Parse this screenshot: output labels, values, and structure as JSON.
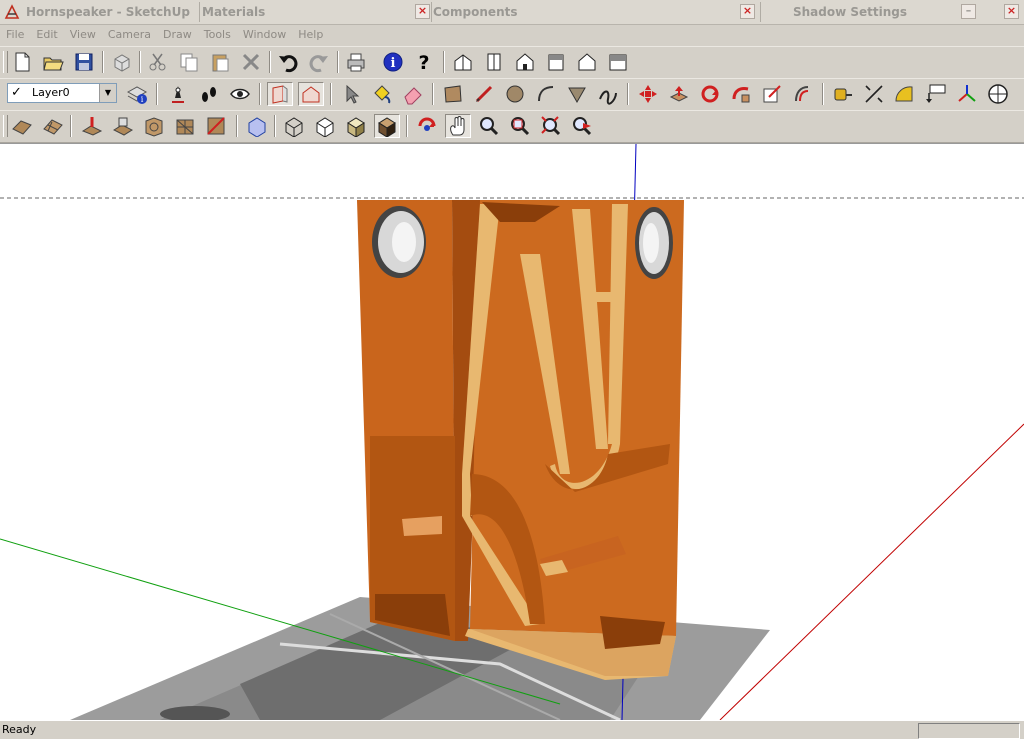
{
  "window": {
    "title": "Hornspeaker - SketchUp",
    "panels": [
      "Materials",
      "Components",
      "Shadow Settings"
    ],
    "close_glyph": "×",
    "minimize_glyph": "–"
  },
  "menu": [
    "File",
    "Edit",
    "View",
    "Camera",
    "Draw",
    "Tools",
    "Window",
    "Help"
  ],
  "layer": {
    "check": "✓",
    "current": "Layer0",
    "drop_glyph": "▼"
  },
  "toolbars": {
    "standard": [
      "new-icon",
      "open-icon",
      "save-icon",
      "make-component-icon",
      "cut-icon",
      "copy-icon",
      "paste-icon",
      "erase-icon",
      "undo-icon",
      "redo-icon",
      "print-icon",
      "model-info-icon",
      "help-icon",
      "iso-view-icon",
      "top-view-icon",
      "front-view-icon",
      "right-view-icon",
      "back-view-icon",
      "left-view-icon"
    ],
    "layers": [
      "layer-manager-icon"
    ],
    "shadows": [
      "shadow-settings-icon",
      "shadows-icon",
      "fog-icon"
    ],
    "sections": [
      "section-plane-icon",
      "section-display-icon"
    ],
    "drawing": [
      "select-icon",
      "paint-bucket-icon",
      "eraser-icon",
      "rectangle-icon",
      "line-icon",
      "circle-icon",
      "arc-icon",
      "polygon-icon",
      "freehand-icon"
    ],
    "edit": [
      "move-icon",
      "push-pull-icon",
      "rotate-icon",
      "follow-me-icon",
      "scale-icon",
      "offset-icon"
    ],
    "construction": [
      "tape-measure-icon",
      "dimension-icon",
      "protractor-icon",
      "text-icon",
      "axes-icon",
      "3d-text-icon"
    ],
    "styles_row": [
      "sandbox-from-contours-icon",
      "sandbox-from-scratch-icon",
      "smoove-icon",
      "stamp-icon",
      "drape-icon",
      "add-detail-icon",
      "flip-edge-icon",
      "xray-icon",
      "wireframe-icon",
      "hidden-line-icon",
      "shaded-icon",
      "shaded-textures-icon",
      "monochrome-icon",
      "orbit-icon",
      "pan-icon",
      "zoom-icon",
      "zoom-window-icon",
      "zoom-extents-icon",
      "previous-view-icon"
    ]
  },
  "status": {
    "text": "Ready"
  },
  "colors": {
    "wood": "#c8641a",
    "mdf": "#e8b870",
    "axis_red": "#c00000",
    "axis_green": "#00a000",
    "axis_blue": "#0000c0",
    "ground": "#9a9a9a"
  }
}
